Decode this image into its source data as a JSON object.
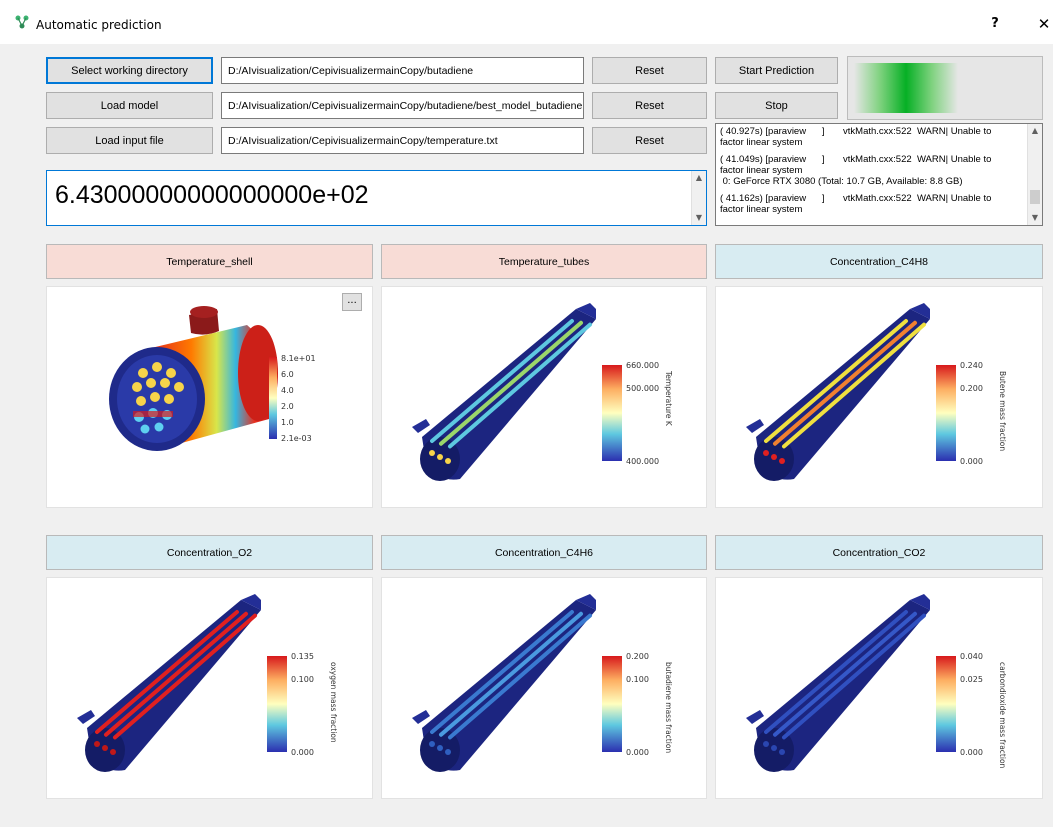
{
  "window": {
    "title": "Automatic prediction",
    "help_label": "?",
    "close_label": "✕"
  },
  "toolbar": {
    "select_dir_label": "Select working directory",
    "load_model_label": "Load model",
    "load_input_label": "Load input file",
    "dir_path": "D:/AIvisualization/CepivisualizermainCopy/butadiene",
    "model_path": "D:/AIvisualization/CepivisualizermainCopy/butadiene/best_model_butadiene",
    "input_path": "D:/AIvisualization/CepivisualizermainCopy/temperature.txt",
    "reset_label": "Reset",
    "start_label": "Start Prediction",
    "stop_label": "Stop"
  },
  "input_value": "6.43000000000000000e+02",
  "log": {
    "lines": [
      "( 40.927s) [paraview      ]       vtkMath.cxx:522  WARN| Unable to",
      "factor linear system",
      "",
      "( 41.049s) [paraview      ]       vtkMath.cxx:522  WARN| Unable to",
      "factor linear system",
      " 0: GeForce RTX 3080 (Total: 10.7 GB, Available: 8.8 GB)",
      "",
      "( 41.162s) [paraview      ]       vtkMath.cxx:522  WARN| Unable to",
      "factor linear system"
    ]
  },
  "progress": {
    "value": 0.5
  },
  "views": [
    {
      "label": "Temperature_shell",
      "tone": "red",
      "more_label": "...",
      "colorbar": {
        "labels": [
          "8.1e+01",
          "6.0",
          "4.0",
          "2.0",
          "1.0",
          "2.1e-03"
        ],
        "title": ""
      }
    },
    {
      "label": "Temperature_tubes",
      "tone": "red",
      "colorbar": {
        "labels": [
          "660.000",
          "500.000",
          "400.000"
        ],
        "title": "Temperature K"
      }
    },
    {
      "label": "Concentration_C4H8",
      "tone": "blue",
      "colorbar": {
        "labels": [
          "0.240",
          "0.200",
          "0.000"
        ],
        "title": "Butene mass fraction"
      }
    },
    {
      "label": "Concentration_O2",
      "tone": "blue",
      "colorbar": {
        "labels": [
          "0.135",
          "0.100",
          "0.000"
        ],
        "title": "oxygen mass fraction"
      }
    },
    {
      "label": "Concentration_C4H6",
      "tone": "blue",
      "colorbar": {
        "labels": [
          "0.200",
          "0.100",
          "0.000"
        ],
        "title": "butadiene mass fraction"
      }
    },
    {
      "label": "Concentration_CO2",
      "tone": "blue",
      "colorbar": {
        "labels": [
          "0.040",
          "0.025",
          "0.000"
        ],
        "title": "carbondioxide mass fraction"
      }
    }
  ],
  "colors": {
    "accent": "#0078d7",
    "progress": "#06b025",
    "tab_red": "#f8dcd6",
    "tab_blue": "#d8ecf2"
  }
}
